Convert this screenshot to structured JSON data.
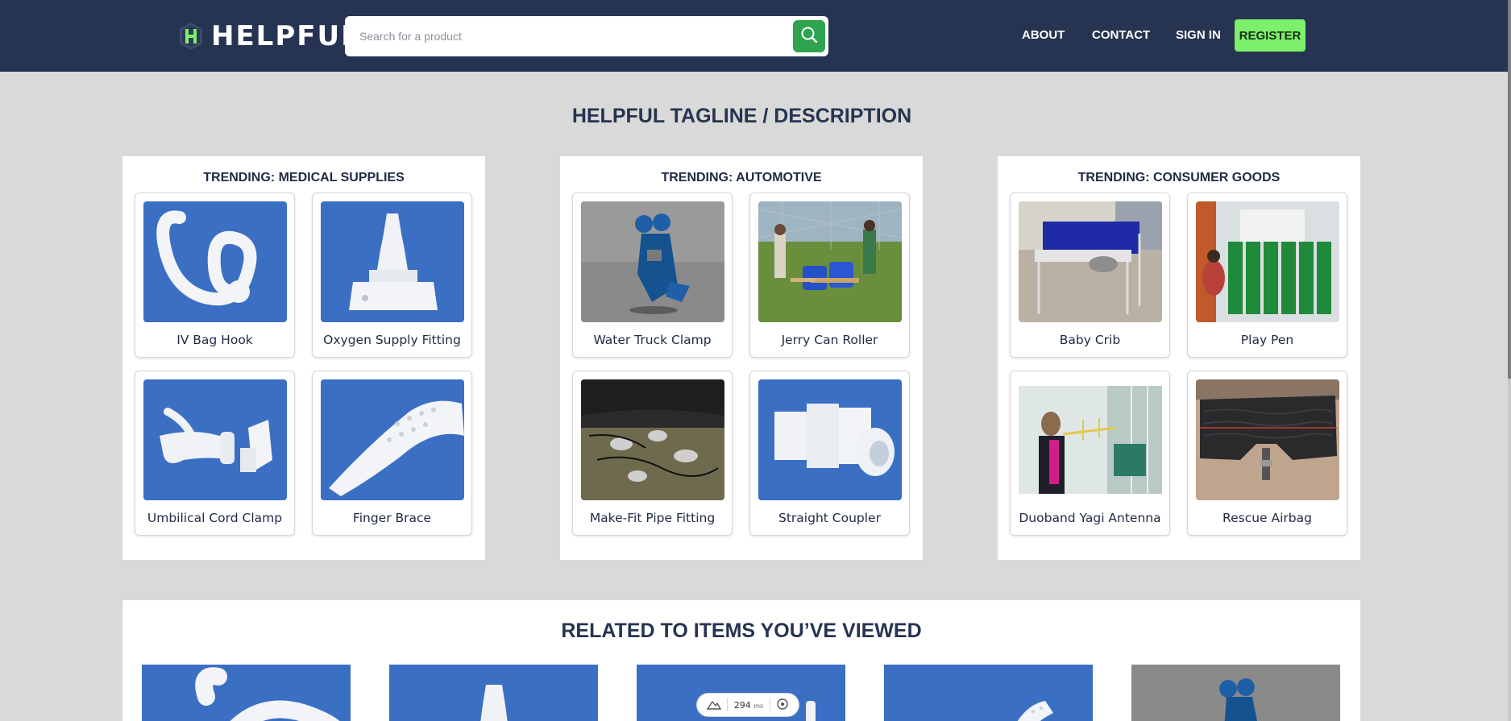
{
  "header": {
    "brand": "HELPFUL",
    "search_placeholder": "Search for a product",
    "nav": {
      "about": "ABOUT",
      "contact": "CONTACT",
      "sign_in": "SIGN IN",
      "register": "REGISTER"
    }
  },
  "tagline": "HELPFUL TAGLINE / DESCRIPTION",
  "panels": [
    {
      "title": "TRENDING: MEDICAL SUPPLIES",
      "items": [
        "IV Bag Hook",
        "Oxygen Supply Fitting",
        "Umbilical Cord Clamp",
        "Finger Brace"
      ]
    },
    {
      "title": "TRENDING: AUTOMOTIVE",
      "items": [
        "Water Truck Clamp",
        "Jerry Can Roller",
        "Make-Fit Pipe Fitting",
        "Straight Coupler"
      ]
    },
    {
      "title": "TRENDING: CONSUMER GOODS",
      "items": [
        "Baby Crib",
        "Play Pen",
        "Duoband Yagi Antenna",
        "Rescue Airbag"
      ]
    }
  ],
  "related": {
    "title": "RELATED TO ITEMS YOU’VE VIEWED"
  },
  "timing_overlay": {
    "value": "294",
    "unit": "ms"
  },
  "colors": {
    "header_bg": "#263451",
    "accent_green": "#7df06b",
    "search_button": "#2ea44f",
    "page_bg": "#d9d9d9",
    "product_blue": "#3a6fc4"
  },
  "icons": [
    "logo-h-icon",
    "search-icon",
    "mountain-icon",
    "target-icon"
  ]
}
